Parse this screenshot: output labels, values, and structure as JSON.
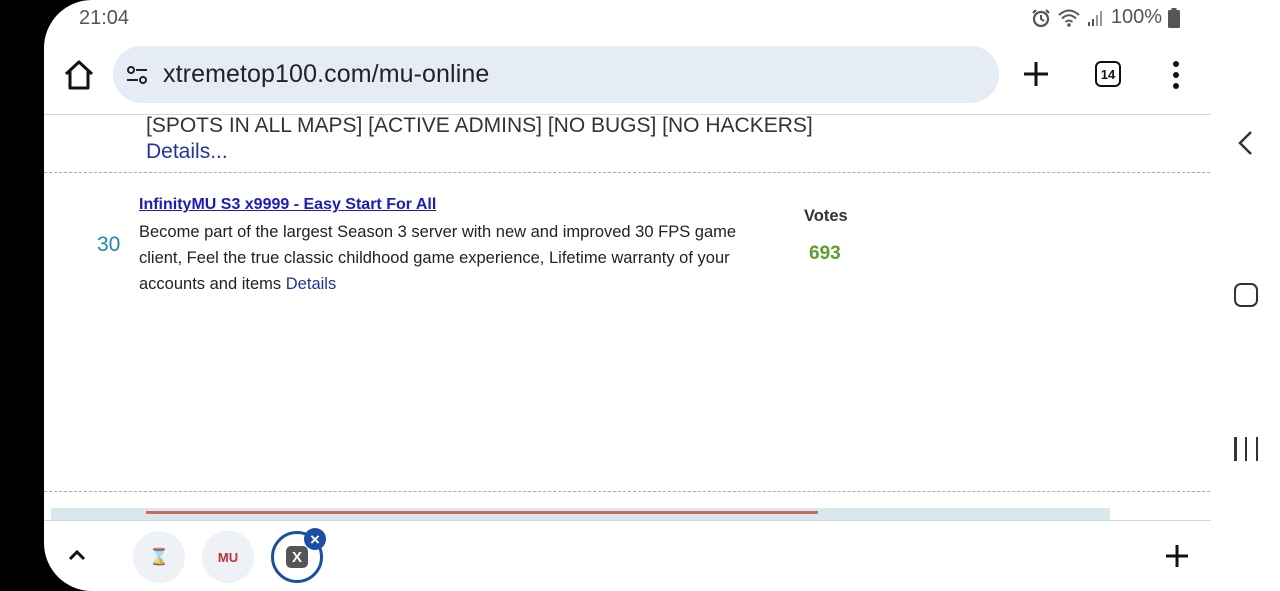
{
  "status": {
    "time": "21:04",
    "battery": "100%"
  },
  "toolbar": {
    "url": "xtremetop100.com/mu-online",
    "tab_count": "14"
  },
  "content": {
    "prev_entry": {
      "description_tail": "[SPOTS IN ALL MAPS] [ACTIVE ADMINS] [NO BUGS] [NO HACKERS]",
      "details_link": "Details..."
    },
    "entry": {
      "rank": "30",
      "title": "InfinityMU S3 x9999 - Easy Start For All",
      "description": "Become part of the largest Season 3 server with new and improved 30 FPS game client, Feel the true classic childhood game experience, Lifetime warranty of your accounts and items",
      "details_link": "Details",
      "votes_label": "Votes",
      "votes_value": "693"
    }
  },
  "bottom_tabs": [
    {
      "icon": "hourglass-icon",
      "label": "⌛"
    },
    {
      "icon": "mu-logo-icon",
      "label": "MU"
    },
    {
      "icon": "x-logo-icon",
      "label": "X"
    }
  ],
  "colors": {
    "url_bar_bg": "#e6ecf6",
    "link": "#1a1acc",
    "votes": "#5aa02c",
    "rank": "#1e88b0",
    "active_tab_ring": "#1a4fa8"
  }
}
